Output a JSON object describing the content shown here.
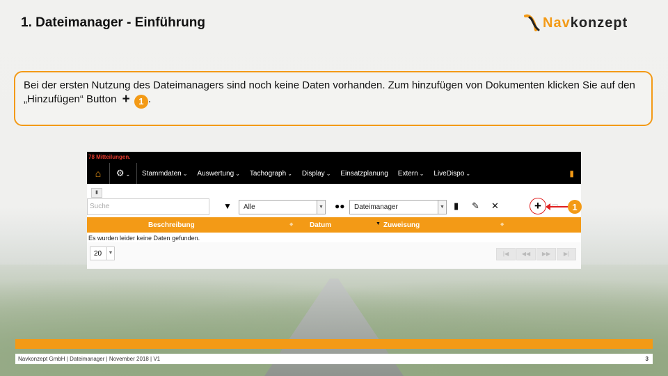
{
  "slide": {
    "title": "1. Dateimanager - Einführung",
    "logo_text_1": "Nav",
    "logo_text_2": "konzept",
    "callout_text_1": "Bei der ersten Nutzung des Dateimanagers sind noch keine Daten vorhanden. Zum hinzufügen von Dokumenten klicken Sie auf den „Hinzufügen“ Button",
    "callout_plus": "+",
    "callout_badge": "1",
    "callout_end": ".",
    "footer_text": "Navkonzept GmbH  |  Dateimanager  |  November 2018  |  V1",
    "page_number": "3"
  },
  "app": {
    "messages": "78 Mitteilungen.",
    "nav": [
      "Stammdaten",
      "Auswertung",
      "Tachograph",
      "Display",
      "Einsatzplanung",
      "Extern",
      "LiveDispo"
    ],
    "search_placeholder": "Suche",
    "filter_select": "Alle",
    "module_select": "Dateimanager",
    "badge": "1",
    "columns": [
      "Beschreibung",
      "Datum",
      "Zuweisung"
    ],
    "empty_text": "Es wurden leider keine Daten gefunden.",
    "page_size": "20"
  },
  "colors": {
    "accent": "#f39a16",
    "highlight": "#e02020"
  },
  "icons": [
    "home-icon",
    "gear-icon",
    "filter-icon",
    "users-icon",
    "bookmark-icon",
    "edit-icon",
    "delete-icon",
    "add-icon"
  ]
}
